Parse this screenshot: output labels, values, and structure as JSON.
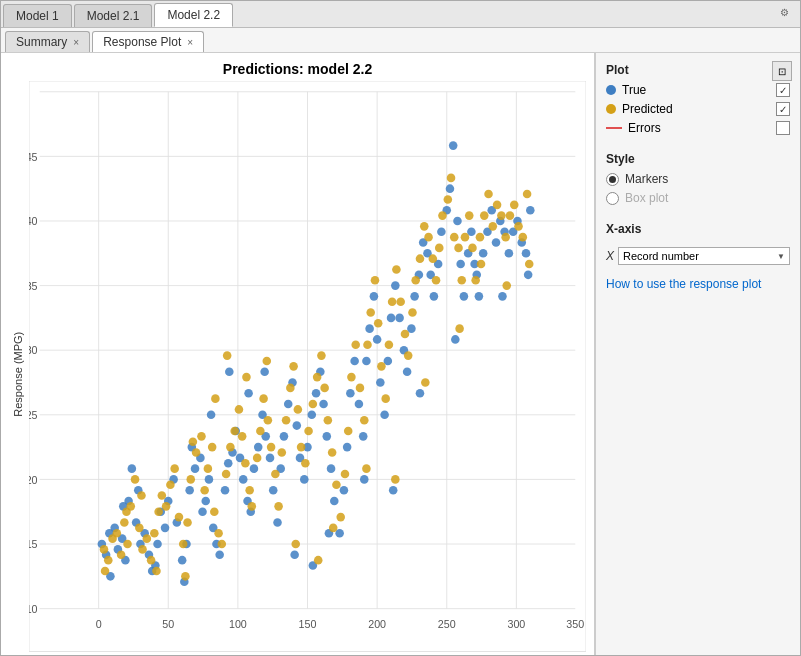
{
  "tabs_top": [
    {
      "label": "Model 1",
      "active": false
    },
    {
      "label": "Model 2.1",
      "active": false
    },
    {
      "label": "Model 2.2",
      "active": true
    }
  ],
  "tabs_secondary": [
    {
      "label": "Summary",
      "closeable": false,
      "active": false
    },
    {
      "label": "Response Plot",
      "closeable": true,
      "active": true
    }
  ],
  "plot": {
    "title": "Predictions: model 2.2",
    "xlabel": "Record number",
    "ylabel": "Response (MPG)"
  },
  "panel": {
    "section_plot": "Plot",
    "legend": [
      {
        "label": "True",
        "color": "#3e7ec2",
        "type": "dot",
        "checked": true
      },
      {
        "label": "Predicted",
        "color": "#d4a017",
        "type": "dot",
        "checked": true
      },
      {
        "label": "Errors",
        "color": "#e05050",
        "type": "line",
        "checked": false
      }
    ],
    "section_style": "Style",
    "style_options": [
      {
        "label": "Markers",
        "selected": true
      },
      {
        "label": "Box plot",
        "selected": false,
        "disabled": true
      }
    ],
    "section_xaxis": "X-axis",
    "xaxis_label": "X",
    "xaxis_value": "Record number",
    "help_text": "How to use the response plot"
  },
  "icons": {
    "expand": "⊡",
    "close": "×"
  }
}
